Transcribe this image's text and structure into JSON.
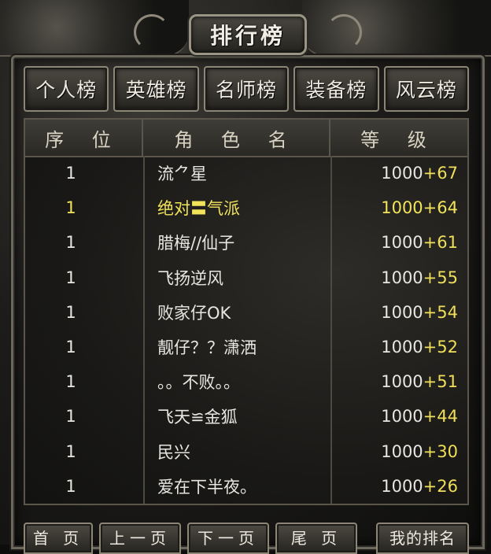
{
  "title": "排行榜",
  "tabs": [
    "个人榜",
    "英雄榜",
    "名师榜",
    "装备榜",
    "风云榜"
  ],
  "headers": {
    "rank": "序 位",
    "name": "角 色 名",
    "level": "等 级"
  },
  "rows": [
    {
      "rank": "1",
      "name": "流⺈星",
      "level": "1000",
      "bonus": "+67",
      "highlight": false
    },
    {
      "rank": "1",
      "name": "绝对〓气派",
      "level": "1000",
      "bonus": "+64",
      "highlight": true
    },
    {
      "rank": "1",
      "name": "腊梅//仙子",
      "level": "1000",
      "bonus": "+61",
      "highlight": false
    },
    {
      "rank": "1",
      "name": "飞扬逆风",
      "level": "1000",
      "bonus": "+55",
      "highlight": false
    },
    {
      "rank": "1",
      "name": "败家仔OK",
      "level": "1000",
      "bonus": "+54",
      "highlight": false
    },
    {
      "rank": "1",
      "name": "靓仔？？潇洒",
      "level": "1000",
      "bonus": "+52",
      "highlight": false
    },
    {
      "rank": "1",
      "name": "。。不败。。",
      "level": "1000",
      "bonus": "+51",
      "highlight": false
    },
    {
      "rank": "1",
      "name": "飞天≌金狐",
      "level": "1000",
      "bonus": "+44",
      "highlight": false
    },
    {
      "rank": "1",
      "name": "民兴",
      "level": "1000",
      "bonus": "+30",
      "highlight": false
    },
    {
      "rank": "1",
      "name": "爱在下半夜。",
      "level": "1000",
      "bonus": "+26",
      "highlight": false
    }
  ],
  "pager": {
    "first": "首 页",
    "prev": "上一页",
    "next": "下一页",
    "last": "尾 页",
    "mine": "我的排名"
  },
  "colors": {
    "highlight": "#f2e45a",
    "bonus": "#f0df5a",
    "text": "#e8e6e0",
    "frame": "#8c8677"
  }
}
